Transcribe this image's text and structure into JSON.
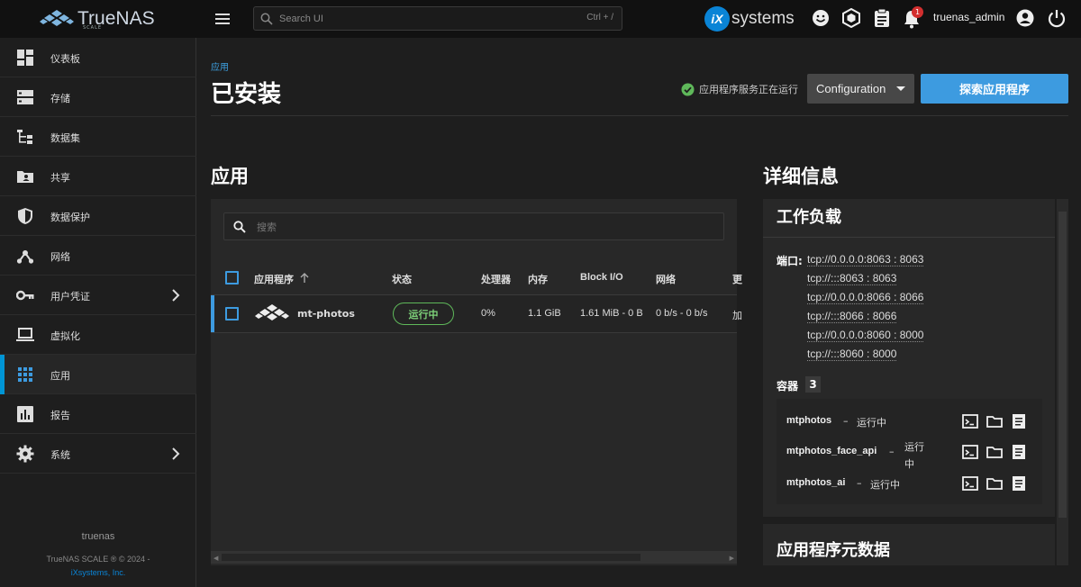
{
  "brand": {
    "name": "TrueNAS",
    "edition": "SCALE",
    "vendor_mark": "iX",
    "vendor_name": "systems"
  },
  "topbar": {
    "search_placeholder": "Search UI",
    "search_shortcut": "Ctrl + /",
    "notification_count": "1",
    "username": "truenas_admin"
  },
  "sidebar": {
    "items": [
      {
        "label": "仪表板",
        "icon": "dashboard-icon"
      },
      {
        "label": "存储",
        "icon": "storage-icon"
      },
      {
        "label": "数据集",
        "icon": "datasets-icon"
      },
      {
        "label": "共享",
        "icon": "shares-icon"
      },
      {
        "label": "数据保护",
        "icon": "shield-icon"
      },
      {
        "label": "网络",
        "icon": "network-icon"
      },
      {
        "label": "用户凭证",
        "icon": "key-icon"
      },
      {
        "label": "虚拟化",
        "icon": "laptop-icon"
      },
      {
        "label": "应用",
        "icon": "apps-grid-icon"
      },
      {
        "label": "报告",
        "icon": "reports-icon"
      },
      {
        "label": "系统",
        "icon": "gear-icon"
      }
    ],
    "hostname": "truenas",
    "copyright": "TrueNAS SCALE ® © 2024 -",
    "company": "iXsystems, Inc."
  },
  "page": {
    "breadcrumb": "应用",
    "title": "已安装",
    "service_status": "应用程序服务正在运行",
    "config_label": "Configuration",
    "discover_label": "探索应用程序"
  },
  "apps": {
    "title": "应用",
    "search_placeholder": "搜索",
    "columns": [
      "应用程序",
      "状态",
      "处理器",
      "内存",
      "Block I/O",
      "网络",
      "更"
    ],
    "rows": [
      {
        "name": "mt-photos",
        "state": "运行中",
        "cpu": "0%",
        "memory": "1.1 GiB",
        "block_io": "1.61 MiB - 0 B",
        "network": "0 b/s - 0 b/s",
        "extra": "加"
      }
    ]
  },
  "details": {
    "title": "详细信息",
    "workload_title": "工作负载",
    "ports_label": "端口:",
    "ports": [
      "tcp://0.0.0.0:8063 : 8063",
      "tcp://:::8063 : 8063",
      "tcp://0.0.0.0:8066 : 8066",
      "tcp://:::8066 : 8066",
      "tcp://0.0.0.0:8060 : 8000",
      "tcp://:::8060 : 8000"
    ],
    "containers_label": "容器",
    "containers_count": "3",
    "containers": [
      {
        "name": "mtphotos",
        "sep": "–",
        "state": "运行中"
      },
      {
        "name": "mtphotos_face_api",
        "sep": "–",
        "state": "运行中"
      },
      {
        "name": "mtphotos_ai",
        "sep": "–",
        "state": "运行中"
      }
    ],
    "metadata_title": "应用程序元数据"
  },
  "colors": {
    "accent": "#3d9be0",
    "running": "#5fb85a",
    "topbar": "#111111"
  }
}
